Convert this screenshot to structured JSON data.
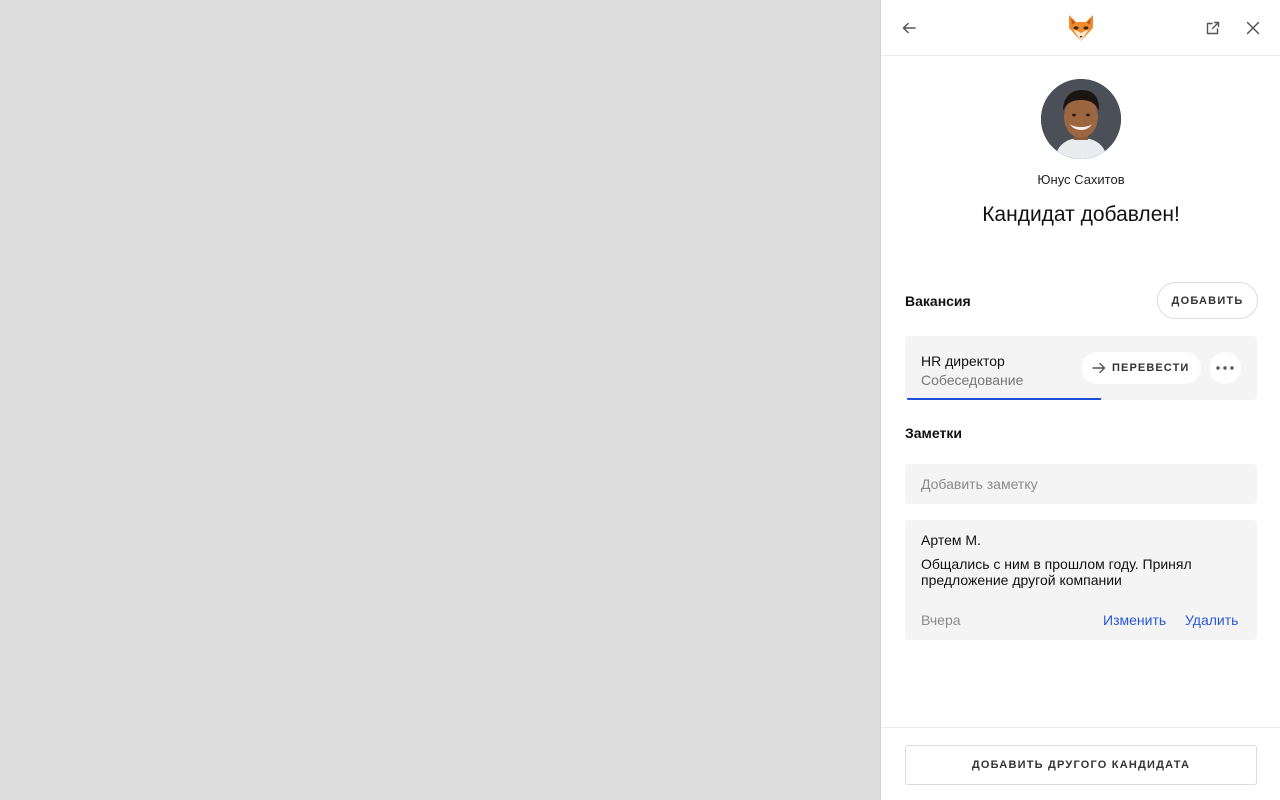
{
  "header": {
    "back_icon": "arrow-left-icon",
    "logo_icon": "fox-logo-icon",
    "external_icon": "open-external-icon",
    "close_icon": "close-icon"
  },
  "candidate": {
    "name": "Юнус Сахитов",
    "headline": "Кандидат добавлен!"
  },
  "vacancy_section": {
    "title": "Вакансия",
    "add_label": "ДОБАВИТЬ",
    "card": {
      "name": "HR директор",
      "stage": "Собеседование",
      "move_label": "ПЕРЕВЕСТИ",
      "move_icon": "arrow-right-icon",
      "more_icon": "more-horizontal-icon"
    },
    "accent_color": "#1e4fd8"
  },
  "notes_section": {
    "title": "Заметки",
    "input_placeholder": "Добавить заметку",
    "notes": [
      {
        "author": "Артем М.",
        "text": "Общались с ним в прошлом году. Принял предложение другой компании",
        "date": "Вчера",
        "edit_label": "Изменить",
        "delete_label": "Удалить"
      }
    ],
    "link_color": "#2a56d6"
  },
  "footer": {
    "add_other_label": "ДОБАВИТЬ ДРУГОГО КАНДИДАТА"
  }
}
